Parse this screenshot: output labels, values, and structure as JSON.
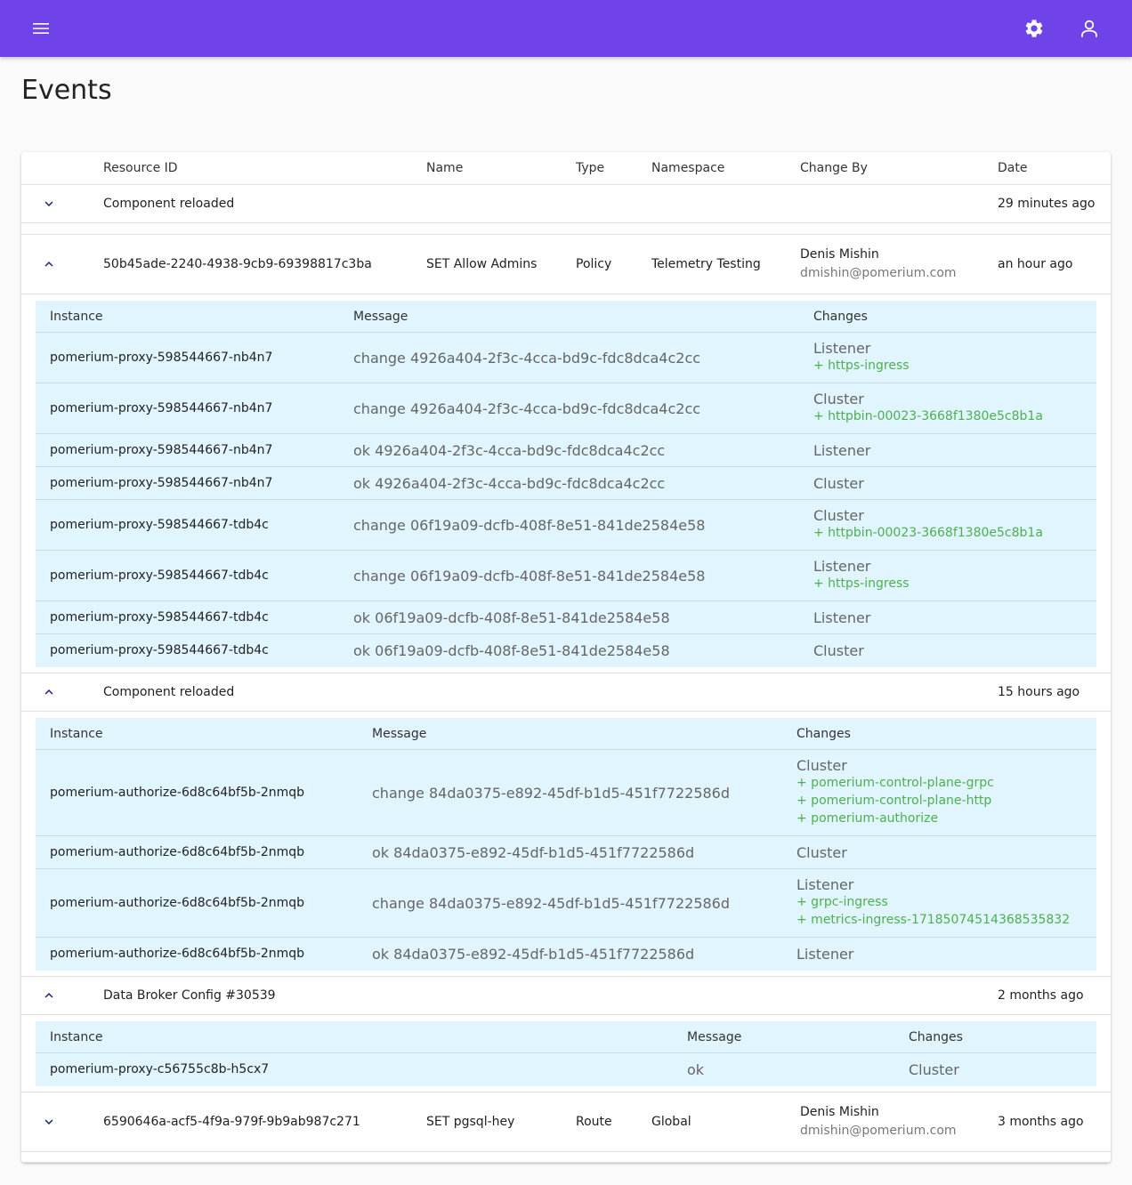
{
  "page": {
    "title": "Events"
  },
  "columns": [
    "Resource ID",
    "Name",
    "Type",
    "Namespace",
    "Change By",
    "Date"
  ],
  "events": [
    {
      "expanded": false,
      "summary": "Component reloaded",
      "date": "29 minutes ago"
    },
    {
      "expanded": true,
      "resource_id": "50b45ade-2240-4938-9cb9-69398817c3ba",
      "name": "SET Allow Admins",
      "type": "Policy",
      "namespace": "Telemetry Testing",
      "change_by_name": "Denis Mishin",
      "change_by_email": "dmishin@pomerium.com",
      "date": "an hour ago",
      "sub_columns": [
        "Instance",
        "Message",
        "Changes"
      ],
      "rows": [
        {
          "instance": "pomerium-proxy-598544667-nb4n7",
          "message": "change 4926a404-2f3c-4cca-bd9c-fdc8dca4c2cc",
          "change": "Listener",
          "adds": [
            "+ https-ingress"
          ]
        },
        {
          "instance": "pomerium-proxy-598544667-nb4n7",
          "message": "change 4926a404-2f3c-4cca-bd9c-fdc8dca4c2cc",
          "change": "Cluster",
          "adds": [
            "+ httpbin-00023-3668f1380e5c8b1a"
          ]
        },
        {
          "instance": "pomerium-proxy-598544667-nb4n7",
          "message": "ok 4926a404-2f3c-4cca-bd9c-fdc8dca4c2cc",
          "change": "Listener",
          "adds": []
        },
        {
          "instance": "pomerium-proxy-598544667-nb4n7",
          "message": "ok 4926a404-2f3c-4cca-bd9c-fdc8dca4c2cc",
          "change": "Cluster",
          "adds": []
        },
        {
          "instance": "pomerium-proxy-598544667-tdb4c",
          "message": "change 06f19a09-dcfb-408f-8e51-841de2584e58",
          "change": "Cluster",
          "adds": [
            "+ httpbin-00023-3668f1380e5c8b1a"
          ]
        },
        {
          "instance": "pomerium-proxy-598544667-tdb4c",
          "message": "change 06f19a09-dcfb-408f-8e51-841de2584e58",
          "change": "Listener",
          "adds": [
            "+ https-ingress"
          ]
        },
        {
          "instance": "pomerium-proxy-598544667-tdb4c",
          "message": "ok 06f19a09-dcfb-408f-8e51-841de2584e58",
          "change": "Listener",
          "adds": []
        },
        {
          "instance": "pomerium-proxy-598544667-tdb4c",
          "message": "ok 06f19a09-dcfb-408f-8e51-841de2584e58",
          "change": "Cluster",
          "adds": []
        }
      ]
    },
    {
      "expanded": true,
      "summary": "Component reloaded",
      "date": "15 hours ago",
      "sub_columns": [
        "Instance",
        "Message",
        "Changes"
      ],
      "rows": [
        {
          "instance": "pomerium-authorize-6d8c64bf5b-2nmqb",
          "message": "change 84da0375-e892-45df-b1d5-451f7722586d",
          "change": "Cluster",
          "adds": [
            "+ pomerium-control-plane-grpc",
            "+ pomerium-control-plane-http",
            "+ pomerium-authorize"
          ]
        },
        {
          "instance": "pomerium-authorize-6d8c64bf5b-2nmqb",
          "message": "ok 84da0375-e892-45df-b1d5-451f7722586d",
          "change": "Cluster",
          "adds": []
        },
        {
          "instance": "pomerium-authorize-6d8c64bf5b-2nmqb",
          "message": "change 84da0375-e892-45df-b1d5-451f7722586d",
          "change": "Listener",
          "adds": [
            "+ grpc-ingress",
            "+ metrics-ingress-17185074514368535832"
          ]
        },
        {
          "instance": "pomerium-authorize-6d8c64bf5b-2nmqb",
          "message": "ok 84da0375-e892-45df-b1d5-451f7722586d",
          "change": "Listener",
          "adds": []
        }
      ]
    },
    {
      "expanded": true,
      "summary": "Data Broker Config #30539",
      "date": "2 months ago",
      "sub_columns": [
        "Instance",
        "Message",
        "Changes"
      ],
      "rows": [
        {
          "instance": "pomerium-proxy-c56755c8b-h5cx7",
          "message": "ok",
          "change": "Cluster",
          "adds": []
        }
      ]
    },
    {
      "expanded": false,
      "resource_id": "6590646a-acf5-4f9a-979f-9b9ab987c271",
      "name": "SET pgsql-hey",
      "type": "Route",
      "namespace": "Global",
      "change_by_name": "Denis Mishin",
      "change_by_email": "dmishin@pomerium.com",
      "date": "3 months ago"
    }
  ]
}
